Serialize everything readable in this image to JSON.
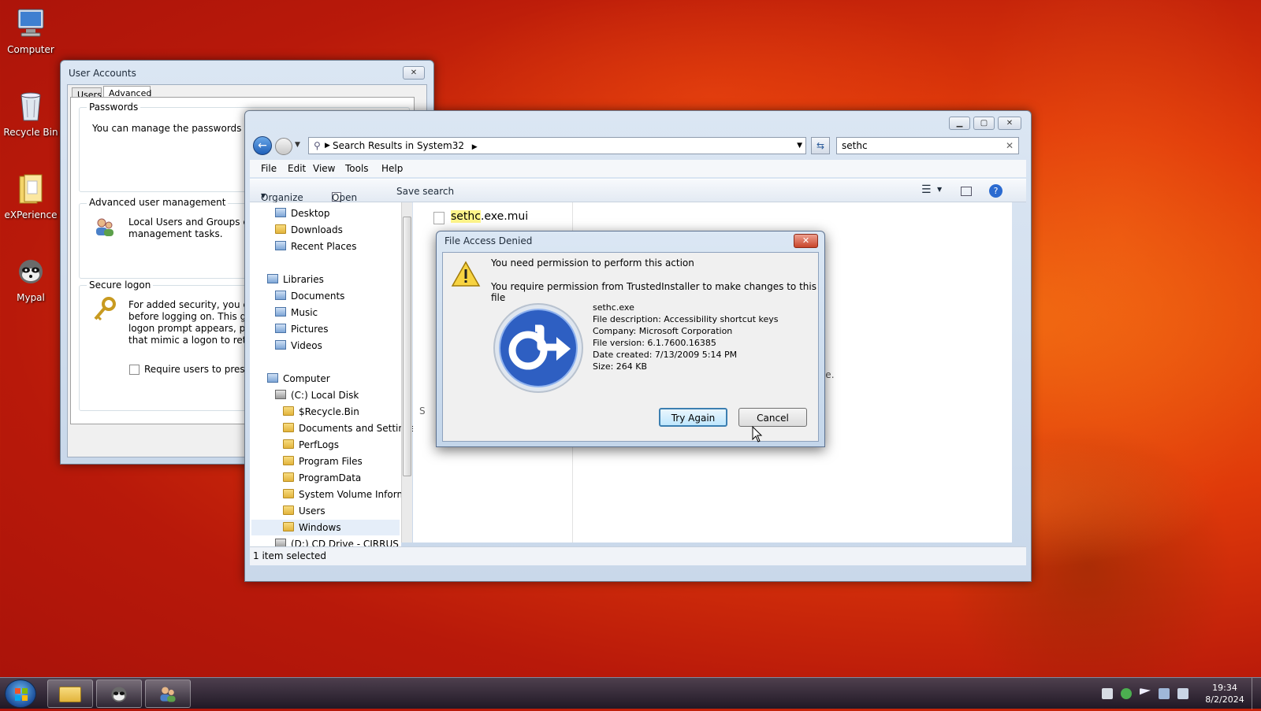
{
  "desktop": {
    "icons": [
      {
        "label": "Computer"
      },
      {
        "label": "Recycle Bin"
      },
      {
        "label": "eXPerience"
      },
      {
        "label": "Mypal"
      }
    ]
  },
  "user_accounts": {
    "title": "User Accounts",
    "tabs": [
      "Users",
      "Advanced"
    ],
    "passwords_title": "Passwords",
    "passwords_text": "You can manage the passwords you",
    "adv_title": "Advanced user management",
    "adv_text_1": "Local Users and Groups can",
    "adv_text_2": "management tasks.",
    "secure_title": "Secure logon",
    "secure_text_1": "For added security, you can",
    "secure_text_2": "before logging on. This gua",
    "secure_text_3": "logon prompt appears, prot",
    "secure_text_4": "that mimic a logon to retrie",
    "checkbox_label": "Require users to press Ct"
  },
  "explorer": {
    "address": "Search Results in System32",
    "search_value": "sethc",
    "menu": [
      "File",
      "Edit",
      "View",
      "Tools",
      "Help"
    ],
    "toolbar": {
      "organize": "Organize",
      "open": "Open",
      "save_search": "Save search"
    },
    "nav": [
      {
        "label": "Desktop"
      },
      {
        "label": "Downloads"
      },
      {
        "label": "Recent Places"
      },
      {
        "label": "Libraries"
      },
      {
        "label": "Documents"
      },
      {
        "label": "Music"
      },
      {
        "label": "Pictures"
      },
      {
        "label": "Videos"
      },
      {
        "label": "Computer"
      },
      {
        "label": "(C:) Local Disk"
      },
      {
        "label": "$Recycle.Bin"
      },
      {
        "label": "Documents and Settings"
      },
      {
        "label": "PerfLogs"
      },
      {
        "label": "Program Files"
      },
      {
        "label": "ProgramData"
      },
      {
        "label": "System Volume Informa"
      },
      {
        "label": "Users"
      },
      {
        "label": "Windows"
      },
      {
        "label": "(D:) CD Drive - CIRRUS"
      }
    ],
    "result_highlight": "sethc",
    "result_rest": ".exe.mui",
    "partial_text": "able.",
    "partial_s": "S",
    "status": "1 item selected"
  },
  "dialog": {
    "title": "File Access Denied",
    "line1": "You need permission to perform this action",
    "line2": "You require permission from TrustedInstaller to make changes to this file",
    "file_name": "sethc.exe",
    "file_desc": "File description: Accessibility shortcut keys",
    "company": "Company: Microsoft Corporation",
    "version": "File version: 6.1.7600.16385",
    "created": "Date created: 7/13/2009 5:14 PM",
    "size": "Size: 264 KB",
    "try_again": "Try Again",
    "cancel": "Cancel"
  },
  "taskbar": {
    "time": "19:34",
    "date": "8/2/2024"
  }
}
